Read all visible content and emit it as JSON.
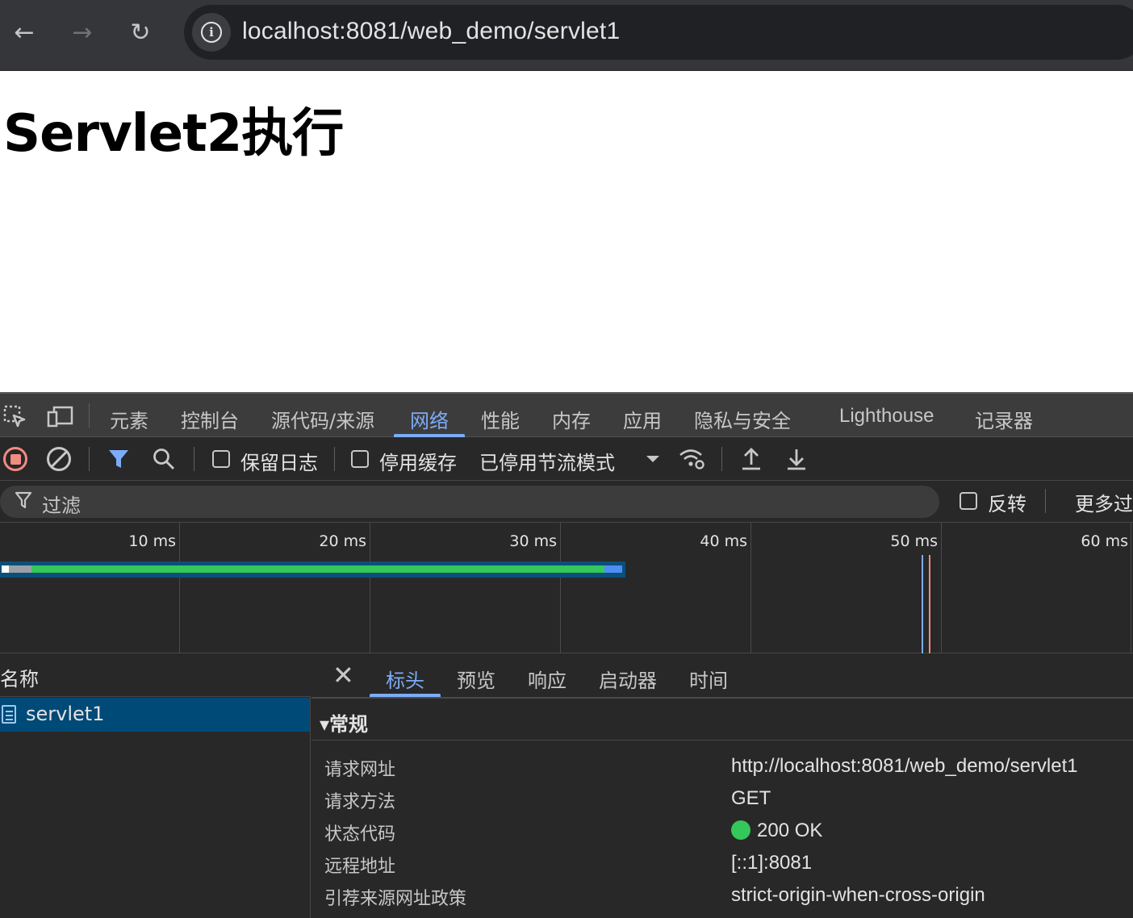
{
  "browser": {
    "url": "localhost:8081/web_demo/servlet1",
    "back_icon": "←",
    "forward_icon": "→",
    "reload_icon": "↻",
    "site_info_icon": "i"
  },
  "page": {
    "heading": "Servlet2执行"
  },
  "devtools": {
    "tabs": [
      "元素",
      "控制台",
      "源代码/来源",
      "网络",
      "性能",
      "内存",
      "应用",
      "隐私与安全",
      "Lighthouse",
      "记录器"
    ],
    "active_tab": "网络",
    "toolbar": {
      "preserve_log": "保留日志",
      "disable_cache": "停用缓存",
      "throttling": "已停用节流模式"
    },
    "filter": {
      "placeholder": "过滤",
      "invert": "反转",
      "more_filters": "更多过"
    },
    "timeline": {
      "ticks": [
        "10 ms",
        "20 ms",
        "30 ms",
        "40 ms",
        "50 ms",
        "60 ms"
      ]
    },
    "requests": {
      "header": "名称",
      "items": [
        "servlet1"
      ]
    },
    "detail": {
      "tabs": [
        "标头",
        "预览",
        "响应",
        "启动器",
        "时间"
      ],
      "active_tab": "标头",
      "section": "▾常规",
      "rows": [
        {
          "key": "请求网址",
          "value": "http://localhost:8081/web_demo/servlet1"
        },
        {
          "key": "请求方法",
          "value": "GET"
        },
        {
          "key": "状态代码",
          "value": "200 OK"
        },
        {
          "key": "远程地址",
          "value": "[::1]:8081"
        },
        {
          "key": "引荐来源网址政策",
          "value": "strict-origin-when-cross-origin"
        }
      ]
    }
  },
  "colors": {
    "accent": "#7cacf8",
    "status_ok": "#34c759",
    "record": "#f28b82"
  }
}
